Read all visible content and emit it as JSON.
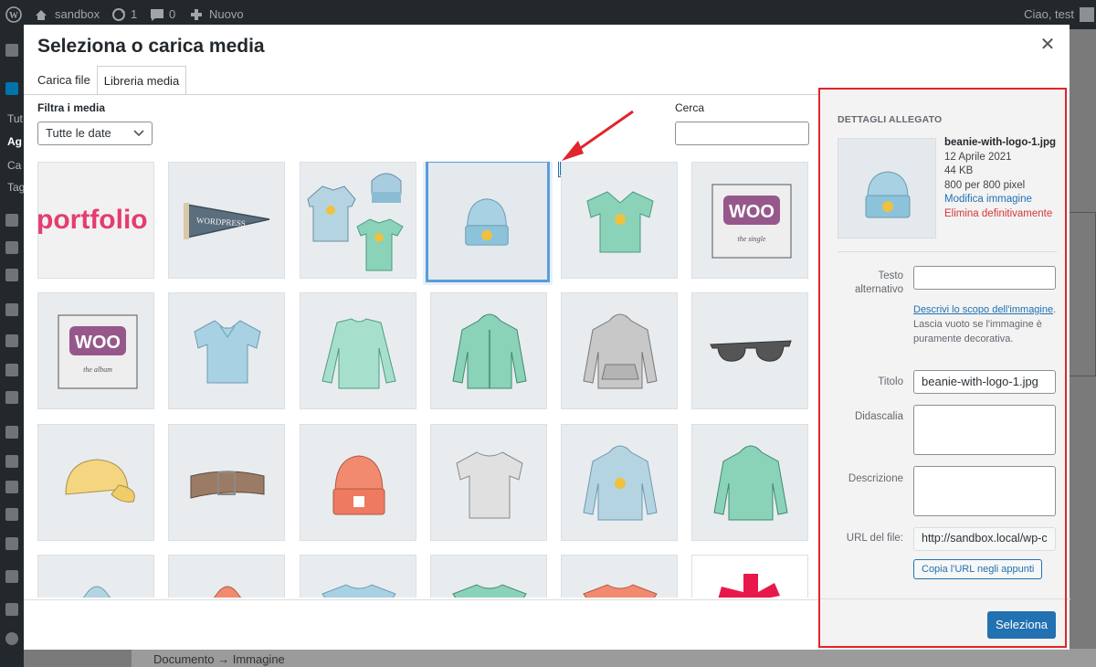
{
  "adminbar": {
    "site_name": "sandbox",
    "updates_count": "1",
    "comments_count": "0",
    "new_label": "Nuovo",
    "greeting": "Ciao, test"
  },
  "adminmenu": {
    "partial_labels": [
      "Tut",
      "Ag",
      "Ca",
      "Tag"
    ]
  },
  "behind": {
    "breadcrumb": "Documento → Immagine"
  },
  "modal": {
    "title": "Seleziona o carica media",
    "tabs": [
      "Carica file",
      "Libreria media"
    ],
    "active_tab": "Libreria media",
    "filter_label": "Filtra i media",
    "date_filter_value": "Tutte le date",
    "search_label": "Cerca",
    "search_value": ""
  },
  "grid": {
    "items": [
      {
        "name": "portfolio",
        "text": "portfolio"
      },
      {
        "name": "pennant",
        "text": "WORDPRESS"
      },
      {
        "name": "logo-collection"
      },
      {
        "name": "beanie-with-logo-1.jpg",
        "selected": true
      },
      {
        "name": "v-neck-tee"
      },
      {
        "name": "album-woo",
        "text": "WOO",
        "subtext": "the single"
      },
      {
        "name": "album-woo-2",
        "text": "WOO",
        "subtext": "the album"
      },
      {
        "name": "polo"
      },
      {
        "name": "long-sleeve-tee"
      },
      {
        "name": "hoodie-with-zipper"
      },
      {
        "name": "hoodie-with-pocket"
      },
      {
        "name": "sunglasses"
      },
      {
        "name": "cap"
      },
      {
        "name": "belt"
      },
      {
        "name": "beanie"
      },
      {
        "name": "t-shirt"
      },
      {
        "name": "hoodie-with-logo"
      },
      {
        "name": "hoodie"
      },
      {
        "name": "row4-1"
      },
      {
        "name": "row4-2"
      },
      {
        "name": "row4-3"
      },
      {
        "name": "row4-4"
      },
      {
        "name": "row4-5"
      },
      {
        "name": "row4-6"
      }
    ]
  },
  "sidebar": {
    "title": "DETTAGLI ALLEGATO",
    "filename": "beanie-with-logo-1.jpg",
    "date": "12 Aprile 2021",
    "size": "44 KB",
    "dimensions": "800 per 800 pixel",
    "edit_link": "Modifica immagine",
    "delete_link": "Elimina definitivamente",
    "alt_label": "Testo alternativo",
    "alt_value": "",
    "help_link": "Descrivi lo scopo dell'immagine",
    "help_text": ". Lascia vuoto se l'immagine è puramente decorativa.",
    "title_label": "Titolo",
    "title_value": "beanie-with-logo-1.jpg",
    "caption_label": "Didascalia",
    "caption_value": "",
    "description_label": "Descrizione",
    "description_value": "",
    "url_label": "URL del file:",
    "url_value": "http://sandbox.local/wp-c",
    "copy_button": "Copia l'URL negli appunti",
    "select_button": "Seleziona"
  },
  "colors": {
    "accent": "#2271b1",
    "danger": "#d63638",
    "annotation_red": "#e0252c",
    "selection_blue": "#5b9dd9"
  }
}
